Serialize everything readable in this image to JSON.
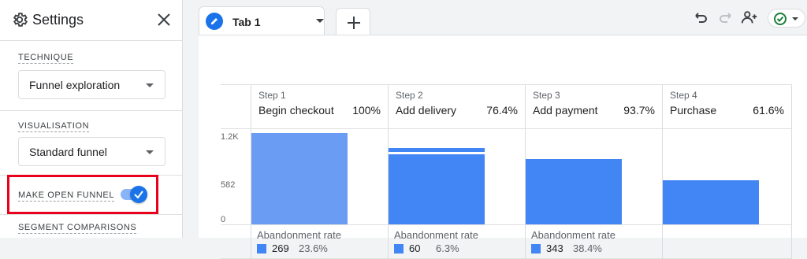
{
  "sidebar": {
    "title": "Settings",
    "technique_label": "TECHNIQUE",
    "technique_value": "Funnel exploration",
    "visualisation_label": "VISUALISATION",
    "visualisation_value": "Standard funnel",
    "open_funnel_label": "MAKE OPEN FUNNEL",
    "open_funnel_enabled": true,
    "segment_label": "SEGMENT COMPARISONS"
  },
  "tabs": [
    {
      "label": "Tab 1",
      "icon": "pencil-icon"
    }
  ],
  "toolbar": {
    "icons": [
      "undo-icon",
      "redo-icon",
      "share-users-icon",
      "check-circle-icon"
    ]
  },
  "colors": {
    "accent": "#1a73e8",
    "bar_primary": "#4285f4",
    "bar_light": "#6a9cf3",
    "highlight": "#e8001c"
  },
  "chart_data": {
    "type": "bar",
    "yticks": [
      "1.2K",
      "582",
      "0"
    ],
    "ylim": [
      0,
      1200
    ],
    "steps": [
      {
        "step_label": "Step 1",
        "name": "Begin checkout",
        "percent": "100%",
        "value": 1140,
        "abandonment_count": "269",
        "abandonment_rate": "23.6%"
      },
      {
        "step_label": "Step 2",
        "name": "Add delivery",
        "percent": "76.4%",
        "value": 871,
        "extra_value": 60,
        "abandonment_count": "60",
        "abandonment_rate": "6.3%"
      },
      {
        "step_label": "Step 3",
        "name": "Add payment",
        "percent": "93.7%",
        "value": 817,
        "abandonment_count": "343",
        "abandonment_rate": "38.4%"
      },
      {
        "step_label": "Step 4",
        "name": "Purchase",
        "percent": "61.6%",
        "value": 550,
        "abandonment_count": "",
        "abandonment_rate": ""
      }
    ],
    "abandonment_label": "Abandonment rate"
  }
}
